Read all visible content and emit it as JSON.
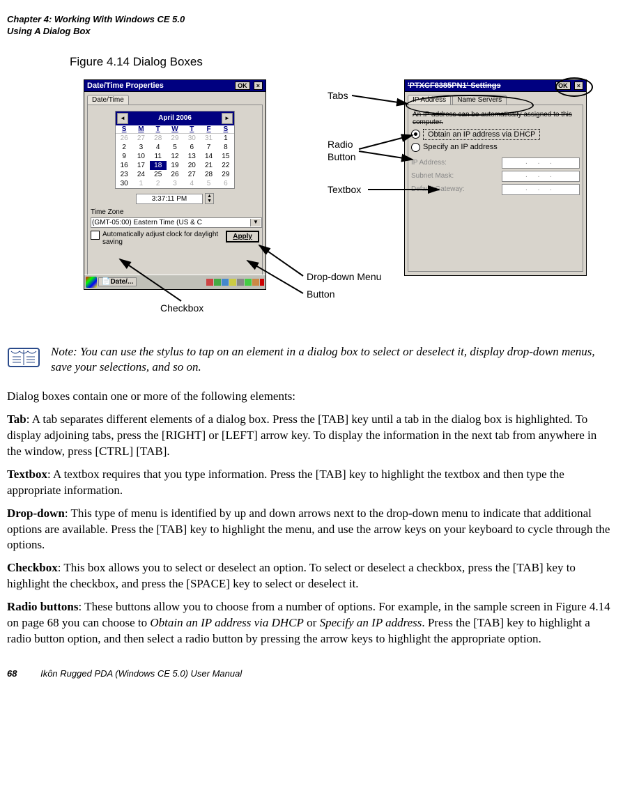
{
  "header": {
    "line1": "Chapter 4:  Working With Windows CE 5.0",
    "line2": "Using A Dialog Box"
  },
  "figure": {
    "title": "Figure 4.14 Dialog Boxes",
    "annotations": {
      "tabs": "Tabs",
      "radio": "Radio",
      "button_label": "Button",
      "textbox": "Textbox",
      "dropdown_menu": "Drop-down Menu",
      "button_annot": "Button",
      "checkbox_annot": "Checkbox"
    },
    "left_shot": {
      "title": "Date/Time Properties",
      "ok": "OK",
      "close": "×",
      "tab1": "Date/Time",
      "cal_month": "April 2006",
      "dow": [
        "S",
        "M",
        "T",
        "W",
        "T",
        "F",
        "S"
      ],
      "days_gray_pre": [
        "26",
        "27",
        "28",
        "29",
        "30",
        "31"
      ],
      "days": [
        "1",
        "2",
        "3",
        "4",
        "5",
        "6",
        "7",
        "8",
        "9",
        "10",
        "11",
        "12",
        "13",
        "14",
        "15",
        "16",
        "17",
        "18",
        "19",
        "20",
        "21",
        "22",
        "23",
        "24",
        "25",
        "26",
        "27",
        "28",
        "29",
        "30"
      ],
      "selected_day": "18",
      "days_gray_post": [
        "1",
        "2",
        "3",
        "4",
        "5",
        "6"
      ],
      "time_value": "3:37:11 PM",
      "tz_label": "Time Zone",
      "tz_value": "(GMT-05:00) Eastern Time (US & C",
      "checkbox_text": "Automatically adjust clock for daylight saving",
      "apply": "Apply",
      "task_label": "Date/..."
    },
    "right_shot": {
      "title": "'PTXCF8385PN1' Settings",
      "ok": "OK",
      "close": "×",
      "tab_active": "IP Address",
      "tab_other": "Name Servers",
      "desc": "An IP address can be automatically assigned to this computer.",
      "radio1": "Obtain an IP address via DHCP",
      "radio2": "Specify an IP address",
      "ip_addr": "IP Address:",
      "subnet": "Subnet Mask:",
      "gateway": "Default Gateway:",
      "ip_placeholder": ".   .   ."
    }
  },
  "note": {
    "label": "Note:",
    "text": "You can use the stylus to tap on an element in a dialog box to select or deselect it, display drop-down menus, save your selections, and so on."
  },
  "body": {
    "intro": "Dialog boxes contain one or more of the following elements:",
    "tab_b": "Tab",
    "tab_t": ": A tab separates different elements of a dialog box. Press the [TAB] key until a tab in the dialog box is highlighted. To display adjoining tabs, press the [RIGHT] or [LEFT] arrow key. To display the information in the next tab from anywhere in the window, press [CTRL] [TAB].",
    "textbox_b": "Textbox",
    "textbox_t": ": A textbox requires that you type information. Press the [TAB] key to highlight the textbox and then type the appropriate information.",
    "dropdown_b": "Drop-down",
    "dropdown_t": ": This type of menu is identified by up and down arrows next to the drop-down menu to indicate that additional options are available. Press the [TAB] key to highlight the menu, and use the arrow keys on your keyboard to cycle through the options.",
    "checkbox_b": "Checkbox",
    "checkbox_t": ": This box allows you to select or deselect an option. To select or deselect a checkbox, press the [TAB] key to highlight the checkbox, and press the [SPACE] key to select or deselect it.",
    "radio_b": "Radio buttons",
    "radio_t1": ": These buttons allow you to choose from a number of options. For example, in the sample screen in Figure 4.14 on page 68 you can choose to ",
    "radio_i1": "Obtain an IP address via DHCP",
    "radio_t2": " or ",
    "radio_i2": "Specify an IP address",
    "radio_t3": ". Press the [TAB] key to highlight a radio button option, and then select a radio button by pressing the arrow keys to highlight the appropriate option."
  },
  "footer": {
    "page": "68",
    "title": "Ikôn Rugged PDA (Windows CE 5.0) User Manual"
  }
}
